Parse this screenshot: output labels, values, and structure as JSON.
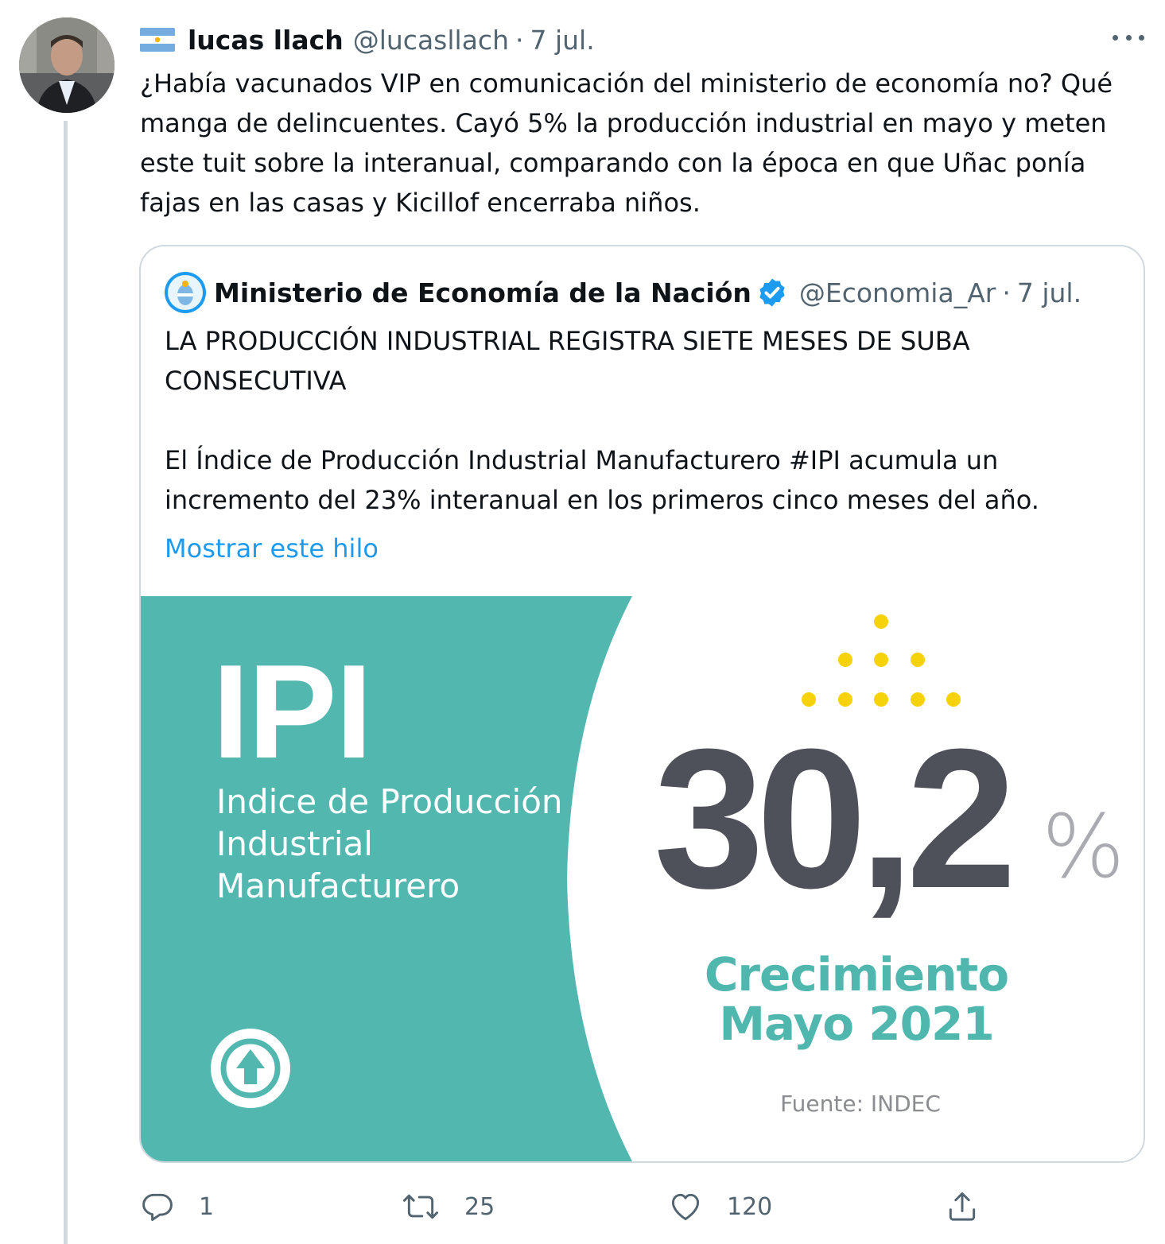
{
  "colors": {
    "text": "#0f1419",
    "secondary": "#536471",
    "link": "#1d9bf0",
    "border": "#cfd9de",
    "teal": "#52b8af",
    "dark_number": "#4e5159",
    "yellow_dots": "#f5d20a"
  },
  "tweet": {
    "author_name": "lucas llach",
    "author_handle": "@lucasllach",
    "separator": "·",
    "date": "7 jul.",
    "text": "¿Había vacunados VIP en comunicación del ministerio de economía no? Qué manga de delincuentes. Cayó 5% la producción industrial en mayo y meten este tuit sobre la interanual, comparando con la época en que Uñac ponía fajas en las casas y Kicillof encerraba niños.",
    "flag_icon": "argentina-flag-icon",
    "more_icon": "more-options-icon"
  },
  "quoted_tweet": {
    "author_name": "Ministerio de Economía de la Nación",
    "author_handle": "@Economia_Ar",
    "separator": "·",
    "date": "7 jul.",
    "paragraph_1": "LA PRODUCCIÓN INDUSTRIAL REGISTRA SIETE MESES DE SUBA CONSECUTIVA",
    "paragraph_2": "El Índice de Producción Industrial Manufacturero #IPI acumula un incremento del 23% interanual en los primeros cinco meses del año.",
    "show_thread": "Mostrar este hilo",
    "verified_icon": "verified-badge-icon"
  },
  "media": {
    "title": "IPI",
    "subtitle": "Indice de Producción\nIndustrial\nManufacturero",
    "value": "30,2",
    "unit": "%",
    "growth_label": "Crecimiento\nMayo 2021",
    "source": "Fuente: INDEC",
    "arrow_icon": "arrow-up-circle-icon"
  },
  "actions": {
    "reply_count": "1",
    "retweet_count": "25",
    "like_count": "120",
    "icons": [
      "reply-icon",
      "retweet-icon",
      "like-icon",
      "share-icon"
    ]
  }
}
